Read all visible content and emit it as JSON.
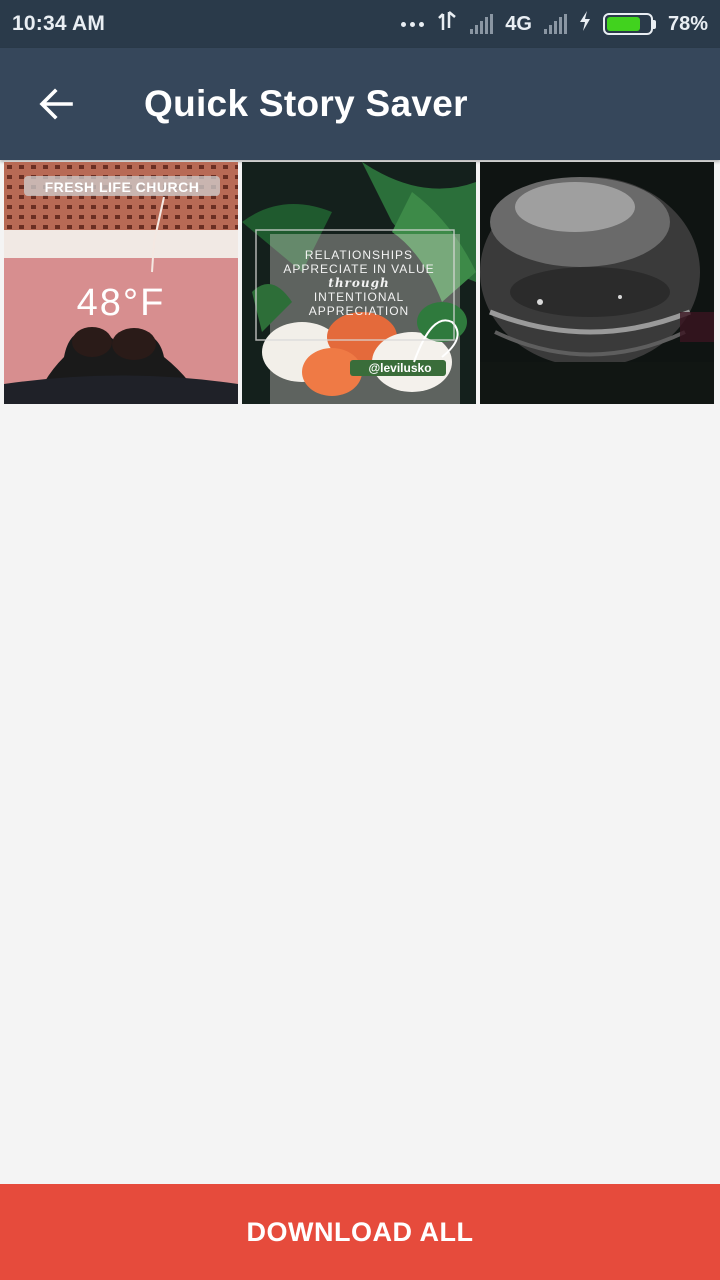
{
  "status_bar": {
    "time": "10:34 AM",
    "network": "4G",
    "battery_percent_label": "78%",
    "battery_level": 0.78
  },
  "app_bar": {
    "title": "Quick Story Saver"
  },
  "stories": [
    {
      "location_sticker": "FRESH LIFE CHURCH",
      "temperature": "48°F"
    },
    {
      "lines": [
        "RELATIONSHIPS",
        "APPRECIATE IN VALUE",
        "through",
        "INTENTIONAL",
        "APPRECIATION"
      ],
      "handle": "@levilusko"
    },
    {}
  ],
  "download_all_label": "DOWNLOAD ALL",
  "colors": {
    "status_bar": "#2a3a4a",
    "app_bar": "#36475b",
    "background": "#f4f4f4",
    "accent": "#e64b3c",
    "battery_fill": "#41d21e"
  }
}
